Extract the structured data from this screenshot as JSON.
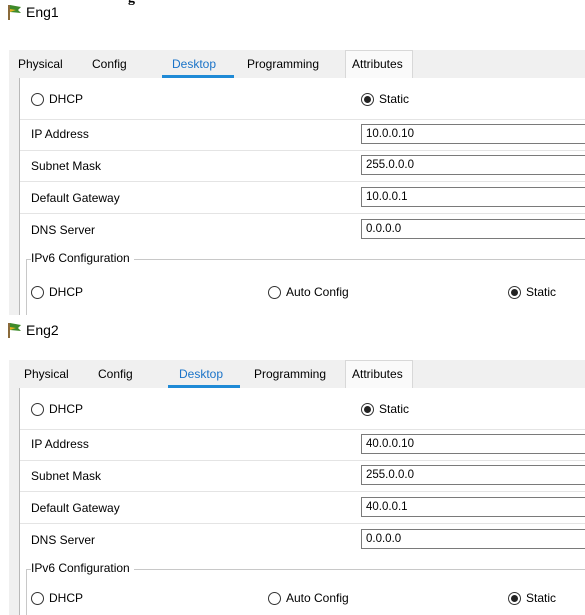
{
  "top_cut_text": "g",
  "windows": [
    {
      "title": "Eng1",
      "tabs": [
        "Physical",
        "Config",
        "Desktop",
        "Programming",
        "Attributes"
      ],
      "active_tab": "Desktop",
      "ipv4": {
        "dhcp_label": "DHCP",
        "static_label": "Static",
        "selected": "Static",
        "ip_address_label": "IP Address",
        "ip_address": "10.0.0.10",
        "subnet_mask_label": "Subnet Mask",
        "subnet_mask": "255.0.0.0",
        "default_gateway_label": "Default Gateway",
        "default_gateway": "10.0.0.1",
        "dns_server_label": "DNS Server",
        "dns_server": "0.0.0.0"
      },
      "ipv6": {
        "section_label": "IPv6 Configuration",
        "dhcp_label": "DHCP",
        "auto_config_label": "Auto Config",
        "static_label": "Static",
        "selected": "Static"
      }
    },
    {
      "title": "Eng2",
      "tabs": [
        "Physical",
        "Config",
        "Desktop",
        "Programming",
        "Attributes"
      ],
      "active_tab": "Desktop",
      "ipv4": {
        "dhcp_label": "DHCP",
        "static_label": "Static",
        "selected": "Static",
        "ip_address_label": "IP Address",
        "ip_address": "40.0.0.10",
        "subnet_mask_label": "Subnet Mask",
        "subnet_mask": "255.0.0.0",
        "default_gateway_label": "Default Gateway",
        "default_gateway": "40.0.0.1",
        "dns_server_label": "DNS Server",
        "dns_server": "0.0.0.0"
      },
      "ipv6": {
        "section_label": "IPv6 Configuration",
        "dhcp_label": "DHCP",
        "auto_config_label": "Auto Config",
        "static_label": "Static",
        "selected": "Static"
      }
    }
  ],
  "colors": {
    "active_tab_text": "#1a73c8",
    "active_tab_underline": "#1f8ad6",
    "panel_background": "#f0f0f0"
  }
}
